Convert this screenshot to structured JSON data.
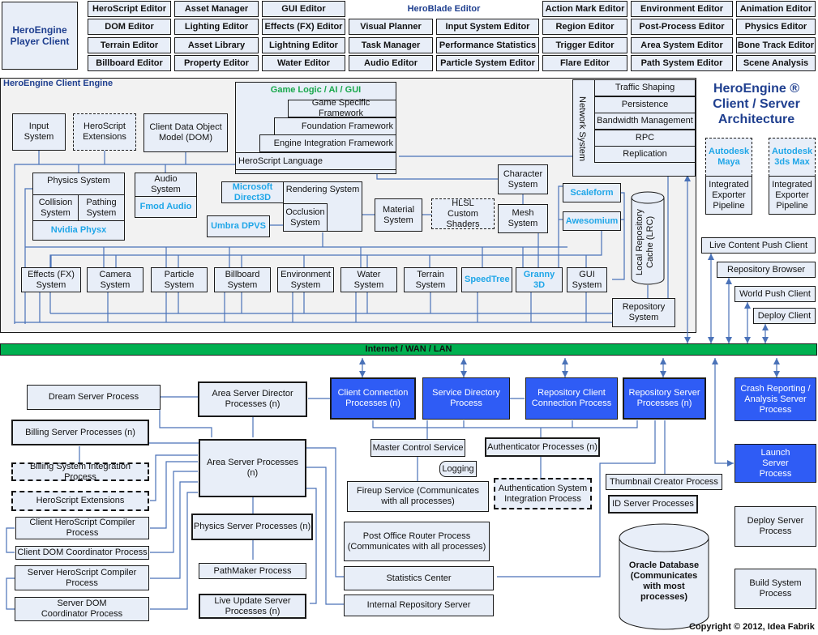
{
  "player_client": "HeroEngine Player Client",
  "heroblade": {
    "title": "HeroBlade Editor",
    "editors": [
      [
        "HeroScript Editor",
        "Asset Manager",
        "GUI Editor",
        "",
        "",
        "Action Mark Editor",
        "Environment Editor",
        "Animation Editor"
      ],
      [
        "DOM Editor",
        "Lighting Editor",
        "Effects (FX) Editor",
        "Visual Planner",
        "Input System Editor",
        "Region Editor",
        "Post-Process Editor",
        "Physics Editor"
      ],
      [
        "Terrain Editor",
        "Asset Library",
        "Lightning Editor",
        "Task Manager",
        "Performance Statistics",
        "Trigger Editor",
        "Area System Editor",
        "Bone Track Editor"
      ],
      [
        "Billboard Editor",
        "Property Editor",
        "Water Editor",
        "Audio Editor",
        "Particle System Editor",
        "Flare Editor",
        "Path System Editor",
        "Scene Analysis"
      ]
    ]
  },
  "title": {
    "line1": "HeroEngine ®",
    "line2": "Client / Server",
    "line3": "Architecture"
  },
  "client_engine": {
    "label": "HeroEngine Client Engine",
    "input_system": "Input System",
    "herosript_extensions": "HeroScript Extensions",
    "client_dom": "Client Data Object Model (DOM)",
    "game_logic": "Game Logic / AI / GUI",
    "game_specific": "Game Specific Framework",
    "foundation": "Foundation Framework",
    "engine_integration": "Engine Integration Framework",
    "herosript_language": "HeroScript Language",
    "network": {
      "label": "Network System",
      "items": [
        "Traffic Shaping",
        "Persistence",
        "Bandwidth Management",
        "RPC",
        "Replication"
      ]
    },
    "physics_system": "Physics System",
    "collision_system": "Collision System",
    "pathing_system": "Pathing System",
    "nvidia_physx": "Nvidia Physx",
    "audio_system": "Audio System",
    "fmod_audio": "Fmod Audio",
    "microsoft_direct3d": "Microsoft Direct3D",
    "rendering_system": "Rendering System",
    "occlusion_system": "Occlusion System",
    "umbra_dpvs": "Umbra DPVS",
    "material_system": "Material System",
    "hlsl_shaders": "HLSL Custom Shaders",
    "character_system": "Character System",
    "mesh_system": "Mesh System",
    "scaleform": "Scaleform",
    "awesomium": "Awesomium",
    "lrc": "Local Repository Cache (LRC)",
    "systems": [
      "Effects (FX) System",
      "Camera System",
      "Particle System",
      "Billboard System",
      "Environment System",
      "Water System",
      "Terrain System",
      "SpeedTree",
      "Granny 3D",
      "GUI System"
    ],
    "repository_system": "Repository System"
  },
  "autodesk": [
    {
      "name": "Autodesk Maya",
      "pipeline": "Integrated Exporter Pipeline"
    },
    {
      "name": "Autodesk 3ds Max",
      "pipeline": "Integrated Exporter Pipeline"
    }
  ],
  "clients": [
    "Live Content Push Client",
    "Repository Browser",
    "World Push Client",
    "Deploy Client"
  ],
  "network_bar": "Internet / WAN / LAN",
  "server": {
    "dream_server": "Dream Server Process",
    "area_director": "Area Server Director Processes (n)",
    "client_connection": "Client Connection Processes (n)",
    "service_directory": "Service Directory Process",
    "repository_client_connection": "Repository Client Connection Process",
    "repository_server": "Repository Server Processes (n)",
    "crash_reporting": "Crash Reporting / Analysis Server Process",
    "billing_server": "Billing Server Processes (n)",
    "billing_integration": "Billing System Integration Process",
    "herosript_extensions": "HeroScript Extensions",
    "client_hs_compiler": "Client HeroScript Compiler Process",
    "client_dom_coordinator": "Client DOM Coordinator Process",
    "server_hs_compiler": "Server HeroScript Compiler Process",
    "server_dom_coordinator": "Server DOM Coordinator Process",
    "area_server": "Area Server Processes (n)",
    "physics_server": "Physics Server Processes (n)",
    "pathmaker": "PathMaker Process",
    "live_update": "Live Update Server Processes (n)",
    "master_control": "Master Control Service",
    "logging": "Logging",
    "authenticator": "Authenticator Processes (n)",
    "auth_integration": "Authentication System Integration Process",
    "fireup": "Fireup Service (Communicates with all processes)",
    "post_office": "Post Office Router Process (Communicates with all processes)",
    "statistics_center": "Statistics Center",
    "internal_repository": "Internal Repository Server",
    "thumbnail_creator": "Thumbnail Creator Process",
    "id_server": "ID Server Processes",
    "oracle": "Oracle Database (Communicates with most processes)",
    "launch_server": "Launch Server Process",
    "deploy_server": "Deploy Server Process",
    "build_system": "Build System Process"
  },
  "copyright": "Copyright © 2012, Idea Fabrik",
  "colors": {
    "network_bar": "#00b050",
    "server_blue": "#2f5cf5",
    "wire": "#4a72b8",
    "accent_cyan": "#1fa6e8",
    "accent_green": "#19a84c",
    "title_navy": "#1f3f8f"
  }
}
